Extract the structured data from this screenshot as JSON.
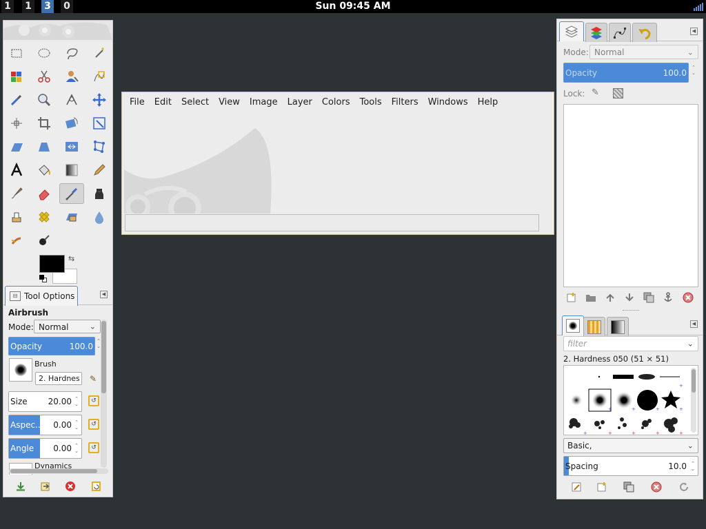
{
  "topbar": {
    "workspaces": [
      "1",
      "1",
      "3",
      "0"
    ],
    "active_workspace_index": 2,
    "clock": "Sun 09:45 AM"
  },
  "menubar": [
    "File",
    "Edit",
    "Select",
    "View",
    "Image",
    "Layer",
    "Colors",
    "Tools",
    "Filters",
    "Windows",
    "Help"
  ],
  "toolbox": {
    "tools": [
      "rect-select-icon",
      "ellipse-select-icon",
      "lasso-icon",
      "fuzzy-select-icon",
      "select-by-color-icon",
      "scissors-icon",
      "foreground-select-icon",
      "paths-icon",
      "color-picker-icon",
      "zoom-icon",
      "measure-icon",
      "move-icon",
      "align-icon",
      "crop-icon",
      "rotate-icon",
      "scale-icon",
      "shear-icon",
      "perspective-icon",
      "flip-icon",
      "cage-icon",
      "text-icon",
      "bucket-fill-icon",
      "blend-icon",
      "pencil-icon",
      "paintbrush-icon",
      "eraser-icon",
      "airbrush-icon",
      "ink-icon",
      "clone-icon",
      "heal-icon",
      "perspective-clone-icon",
      "blur-icon",
      "smudge-icon",
      "dodge-burn-icon"
    ],
    "selected_tool": "airbrush-icon",
    "fg_color": "#000000",
    "bg_color": "#ffffff"
  },
  "tool_options": {
    "tab_label": "Tool Options",
    "title": "Airbrush",
    "mode_label": "Mode:",
    "mode_value": "Normal",
    "opacity_label": "Opacity",
    "opacity_value": "100.0",
    "opacity_fraction": 1.0,
    "brush_label": "Brush",
    "brush_value": "2. Hardnes",
    "size_label": "Size",
    "size_value": "20.00",
    "aspect_label": "Aspec...",
    "aspect_value": "0.00",
    "angle_label": "Angle",
    "angle_value": "0.00",
    "dynamics_label": "Dynamics"
  },
  "layers": {
    "mode_label": "Mode:",
    "mode_value": "Normal",
    "opacity_label": "Opacity",
    "opacity_value": "100.0",
    "opacity_fraction": 1.0,
    "lock_label": "Lock:"
  },
  "brushes": {
    "filter_placeholder": "filter",
    "selected_brush": "2. Hardness 050 (51 × 51)",
    "tag_value": "Basic,",
    "spacing_label": "Spacing",
    "spacing_value": "10.0",
    "spacing_fraction": 0.1
  },
  "colors": {
    "accent": "#4a8ad8",
    "desktop": "#2d3335",
    "active_workspace": "#3e6fa8"
  }
}
